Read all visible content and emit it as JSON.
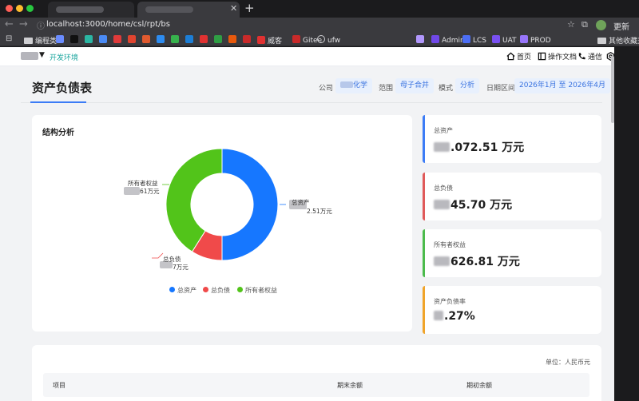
{
  "browser": {
    "url": "localhost:3000/home/csl/rpt/bs",
    "update_label": "更新",
    "bookmarks": [
      {
        "label": "编程类",
        "icon": "folder-icon",
        "color": "#cfcfd2"
      },
      {
        "label": "",
        "icon": "bookmark-icon",
        "color": "#6a8cff"
      },
      {
        "label": "",
        "icon": "ai-icon",
        "color": "#111111"
      },
      {
        "label": "",
        "icon": "bookmark-icon",
        "color": "#2bb6a3"
      },
      {
        "label": "",
        "icon": "bookmark-icon",
        "color": "#4a8af4"
      },
      {
        "label": "",
        "icon": "bookmark-icon",
        "color": "#e03a3a"
      },
      {
        "label": "",
        "icon": "bookmark-icon",
        "color": "#e0442f"
      },
      {
        "label": "",
        "icon": "bookmark-icon",
        "color": "#e05a2f"
      },
      {
        "label": "",
        "icon": "bookmark-icon",
        "color": "#2d8cf0"
      },
      {
        "label": "",
        "icon": "bookmark-icon",
        "color": "#37b24d"
      },
      {
        "label": "",
        "icon": "bookmark-icon",
        "color": "#1c7ed6"
      },
      {
        "label": "",
        "icon": "bookmark-icon",
        "color": "#e03131"
      },
      {
        "label": "",
        "icon": "bookmark-icon",
        "color": "#2f9e44"
      },
      {
        "label": "",
        "icon": "bookmark-icon",
        "color": "#e8590c"
      },
      {
        "label": "",
        "icon": "bookmark-icon",
        "color": "#c92a2a"
      },
      {
        "label": "威客",
        "icon": "bookmark-icon",
        "color": "#e03131"
      },
      {
        "label": "Gitee",
        "icon": "bookmark-icon",
        "color": "#c92a2a"
      },
      {
        "label": "ufw",
        "icon": "globe-icon",
        "color": "#cfcfd2"
      },
      {
        "label": "",
        "icon": "bookmark-icon",
        "color": "#b197fc"
      },
      {
        "label": "Admin",
        "icon": "bookmark-icon",
        "color": "#7048e8"
      },
      {
        "label": "LCS",
        "icon": "bookmark-icon",
        "color": "#4c6ef5"
      },
      {
        "label": "UAT",
        "icon": "bookmark-icon",
        "color": "#7950f2"
      },
      {
        "label": "PROD",
        "icon": "bookmark-icon",
        "color": "#9775fa"
      },
      {
        "label": "其他收藏夹",
        "icon": "folder-icon",
        "color": "#cfcfd2"
      }
    ]
  },
  "topbar": {
    "env_label": "开发环境",
    "nav": [
      {
        "label": "首页",
        "icon": "home-icon"
      },
      {
        "label": "操作文档",
        "icon": "document-icon"
      },
      {
        "label": "通信",
        "icon": "phone-icon"
      },
      {
        "label": "设置",
        "icon": "gear-icon"
      }
    ]
  },
  "header": {
    "title": "资产负债表",
    "filters": {
      "company_label": "公司",
      "company_value": "化学",
      "scope_label": "范围",
      "scope_value": "母子合并",
      "mode_label": "模式",
      "mode_value": "分析",
      "date_label": "日期区间",
      "date_value": "2026年1月 至 2026年4月"
    }
  },
  "chart_card": {
    "title": "结构分析",
    "callouts": {
      "assets_name": "总资产",
      "assets_value": "2.51万元",
      "liabilities_name": "总负债",
      "liabilities_value": "7万元",
      "equity_name": "所有者权益",
      "equity_value": "61万元"
    }
  },
  "chart_data": {
    "type": "pie",
    "title": "结构分析",
    "donut": true,
    "categories": [
      "总资产",
      "总负债",
      "所有者权益"
    ],
    "values": [
      50,
      9,
      41
    ],
    "colors": [
      "#1677ff",
      "#f04a4a",
      "#52c41a"
    ],
    "legend": "bottom"
  },
  "stats": [
    {
      "label": "总资产",
      "value": ".072.51 万元",
      "color": "#3c7cf6"
    },
    {
      "label": "总负债",
      "value": "45.70 万元",
      "color": "#e05a5a"
    },
    {
      "label": "所有者权益",
      "value": "626.81 万元",
      "color": "#4cbb4c"
    },
    {
      "label": "资产负债率",
      "value": ".27%",
      "color": "#f0a42a"
    }
  ],
  "table": {
    "unit_label": "单位：人民币元",
    "columns": [
      "项目",
      "期末余额",
      "期初余额"
    ]
  }
}
